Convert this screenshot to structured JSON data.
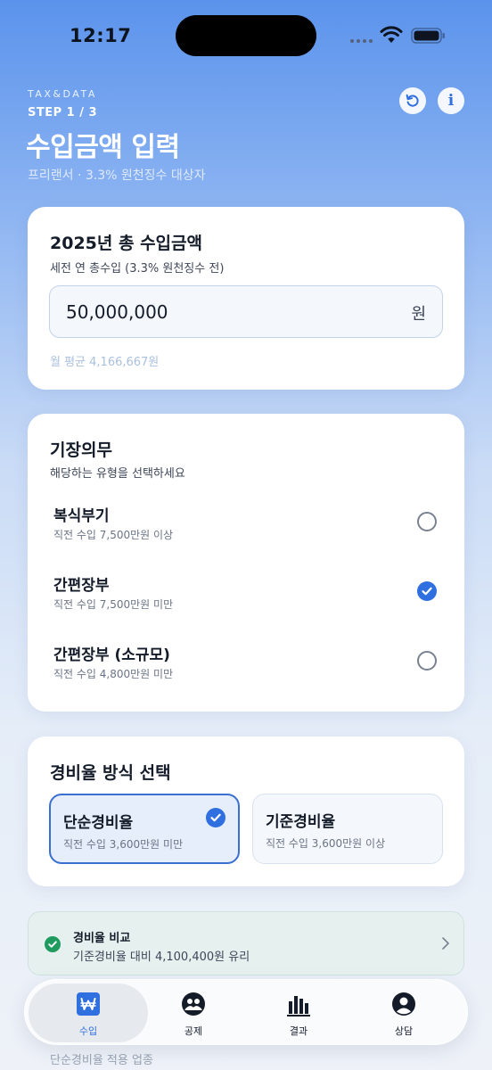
{
  "status_bar": {
    "time": "12:17"
  },
  "header": {
    "brand": "TAX&DATA",
    "step": "STEP 1 / 3",
    "title": "수입금액 입력",
    "subtitle": "프리랜서 · 3.3% 원천징수 대상자",
    "actions": [
      "reset-icon",
      "info-icon"
    ],
    "info_glyph": "i"
  },
  "income": {
    "title": "2025년 총 수입금액",
    "subtitle": "세전 연 총수입 (3.3% 원천징수 전)",
    "value": "50,000,000",
    "unit": "원",
    "monthly": "월 평균 4,166,667원"
  },
  "bookkeeping": {
    "title": "기장의무",
    "subtitle": "해당하는 유형을 선택하세요",
    "options": [
      {
        "name": "복식부기",
        "desc": "직전 수입 7,500만원 이상",
        "selected": false
      },
      {
        "name": "간편장부",
        "desc": "직전 수입 7,500만원 미만",
        "selected": true
      },
      {
        "name": "간편장부 (소규모)",
        "desc": "직전 수입 4,800만원 미만",
        "selected": false
      }
    ]
  },
  "expense_rate": {
    "title": "경비율 방식 선택",
    "options": [
      {
        "name": "단순경비율",
        "desc": "직전 수입 3,600만원 미만",
        "selected": true
      },
      {
        "name": "기준경비율",
        "desc": "직전 수입 3,600만원 이상",
        "selected": false
      }
    ]
  },
  "comparison": {
    "title": "경비율 비교",
    "desc": "기준경비율 대비 4,100,400원 유리"
  },
  "tabbar": {
    "tabs": [
      {
        "label": "수입",
        "icon": "won-icon",
        "active": true
      },
      {
        "label": "공제",
        "icon": "people-icon",
        "active": false
      },
      {
        "label": "결과",
        "icon": "bar-chart-icon",
        "active": false
      },
      {
        "label": "상담",
        "icon": "person-icon",
        "active": false
      }
    ]
  },
  "peek_text": "단순경비율 적용 업종",
  "colors": {
    "accent": "#2f6fe0",
    "success": "#1f9b60",
    "header_top": "#5b93ec"
  }
}
